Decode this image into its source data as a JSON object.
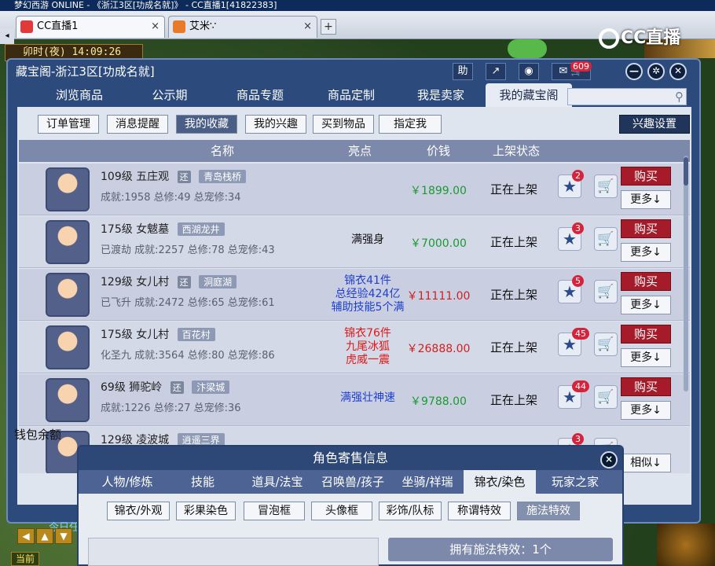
{
  "browser": {
    "title": "梦幻西游 ONLINE - 《浙江3区[功成名就]》 - CC直播1[41822383]",
    "tabs": [
      {
        "label": "CC直播1",
        "close": "×"
      },
      {
        "label": "艾米∵",
        "close": "×"
      }
    ],
    "new_tab": "+"
  },
  "hud": {
    "clock_period": "卯时(夜)",
    "clock_time": "14:09:26",
    "cc_logo": "CC直播",
    "task_hint": "今日任务",
    "current_label": "当前"
  },
  "window": {
    "title": "藏宝阁-浙江3区[功成名就]",
    "help_label": "助",
    "message_count": "609",
    "nav_tabs": [
      "浏览商品",
      "公示期",
      "商品专题",
      "商品定制",
      "我是卖家",
      "我的藏宝阁"
    ],
    "active_nav": 5,
    "search_placeholder": "",
    "sub_tabs": [
      "订单管理",
      "消息提醒",
      "我的收藏",
      "我的兴趣",
      "买到物品",
      "指定我"
    ],
    "active_sub": 2,
    "interest_settings": "兴趣设置",
    "columns": {
      "name": "名称",
      "highlight": "亮点",
      "price": "价钱",
      "status": "上架状态"
    },
    "wallet_label": "钱包余额"
  },
  "rows": [
    {
      "level": "109级",
      "school": "五庄观",
      "returned": "还",
      "server": "青岛栈桥",
      "stats": "成就:1958 总修:49 总宠修:34",
      "highlight": [
        "",
        "",
        ""
      ],
      "highlight_color": "#1e3fd0",
      "price": "￥1899.00",
      "price_color": "#1a9a30",
      "status": "正在上架",
      "fav_count": "2",
      "buy": "购买",
      "more": "更多↓"
    },
    {
      "level": "175级",
      "school": "女魃墓",
      "returned": "",
      "server": "西湖龙井",
      "stats": "已渡劫 成就:2257 总修:78 总宠修:43",
      "highlight": [
        "满强身",
        "",
        ""
      ],
      "highlight_color": "#111111",
      "price": "￥7000.00",
      "price_color": "#1a9a30",
      "status": "正在上架",
      "fav_count": "3",
      "buy": "购买",
      "more": "更多↓"
    },
    {
      "level": "129级",
      "school": "女儿村",
      "returned": "还",
      "server": "洞庭湖",
      "stats": "已飞升 成就:2472 总修:65 总宠修:61",
      "highlight": [
        "锦衣41件",
        "总经验424亿",
        "辅助技能5个满"
      ],
      "highlight_color": "#1e3fd0",
      "price": "￥11111.00",
      "price_color": "#d21e1e",
      "status": "正在上架",
      "fav_count": "5",
      "buy": "购买",
      "more": "更多↓"
    },
    {
      "level": "175级",
      "school": "女儿村",
      "returned": "",
      "server": "百花村",
      "stats": "化圣九 成就:3564 总修:80 总宠修:86",
      "highlight": [
        "锦衣76件",
        "九尾冰狐",
        "虎威一震"
      ],
      "highlight_color": "#e01818",
      "price": "￥26888.00",
      "price_color": "#d21e1e",
      "status": "正在上架",
      "fav_count": "45",
      "buy": "购买",
      "more": "更多↓"
    },
    {
      "level": "69级",
      "school": "狮驼岭",
      "returned": "还",
      "server": "汴梁城",
      "stats": "成就:1226 总修:27 总宠修:36",
      "highlight": [
        "满强壮神速",
        "",
        ""
      ],
      "highlight_color": "#1e3fd0",
      "price": "￥9788.00",
      "price_color": "#1a9a30",
      "status": "正在上架",
      "fav_count": "44",
      "buy": "购买",
      "more": "更多↓"
    },
    {
      "level": "129级",
      "school": "凌波城",
      "returned": "",
      "server": "逍遥三界",
      "stats": "",
      "highlight": [
        "",
        "",
        ""
      ],
      "highlight_color": "#1e3fd0",
      "price": "",
      "price_color": "#1a9a30",
      "status": "",
      "fav_count": "3",
      "buy": "",
      "more": "相似↓"
    }
  ],
  "role_panel": {
    "title": "角色寄售信息",
    "close": "×",
    "tabs": [
      "人物/修炼",
      "技能",
      "道具/法宝",
      "召唤兽/孩子",
      "坐骑/祥瑞",
      "锦衣/染色",
      "玩家之家"
    ],
    "active_tab": 5,
    "sub_tabs": [
      "锦衣/外观",
      "彩果染色",
      "冒泡框",
      "头像框",
      "彩饰/队标",
      "称谓特效",
      "施法特效"
    ],
    "active_sub": 6,
    "effect_count": "拥有施法特效：1个"
  },
  "colors": {
    "window_bg": "#2c4a7c",
    "header_bg": "#7d89ab",
    "buy_red": "#a51b2a"
  }
}
